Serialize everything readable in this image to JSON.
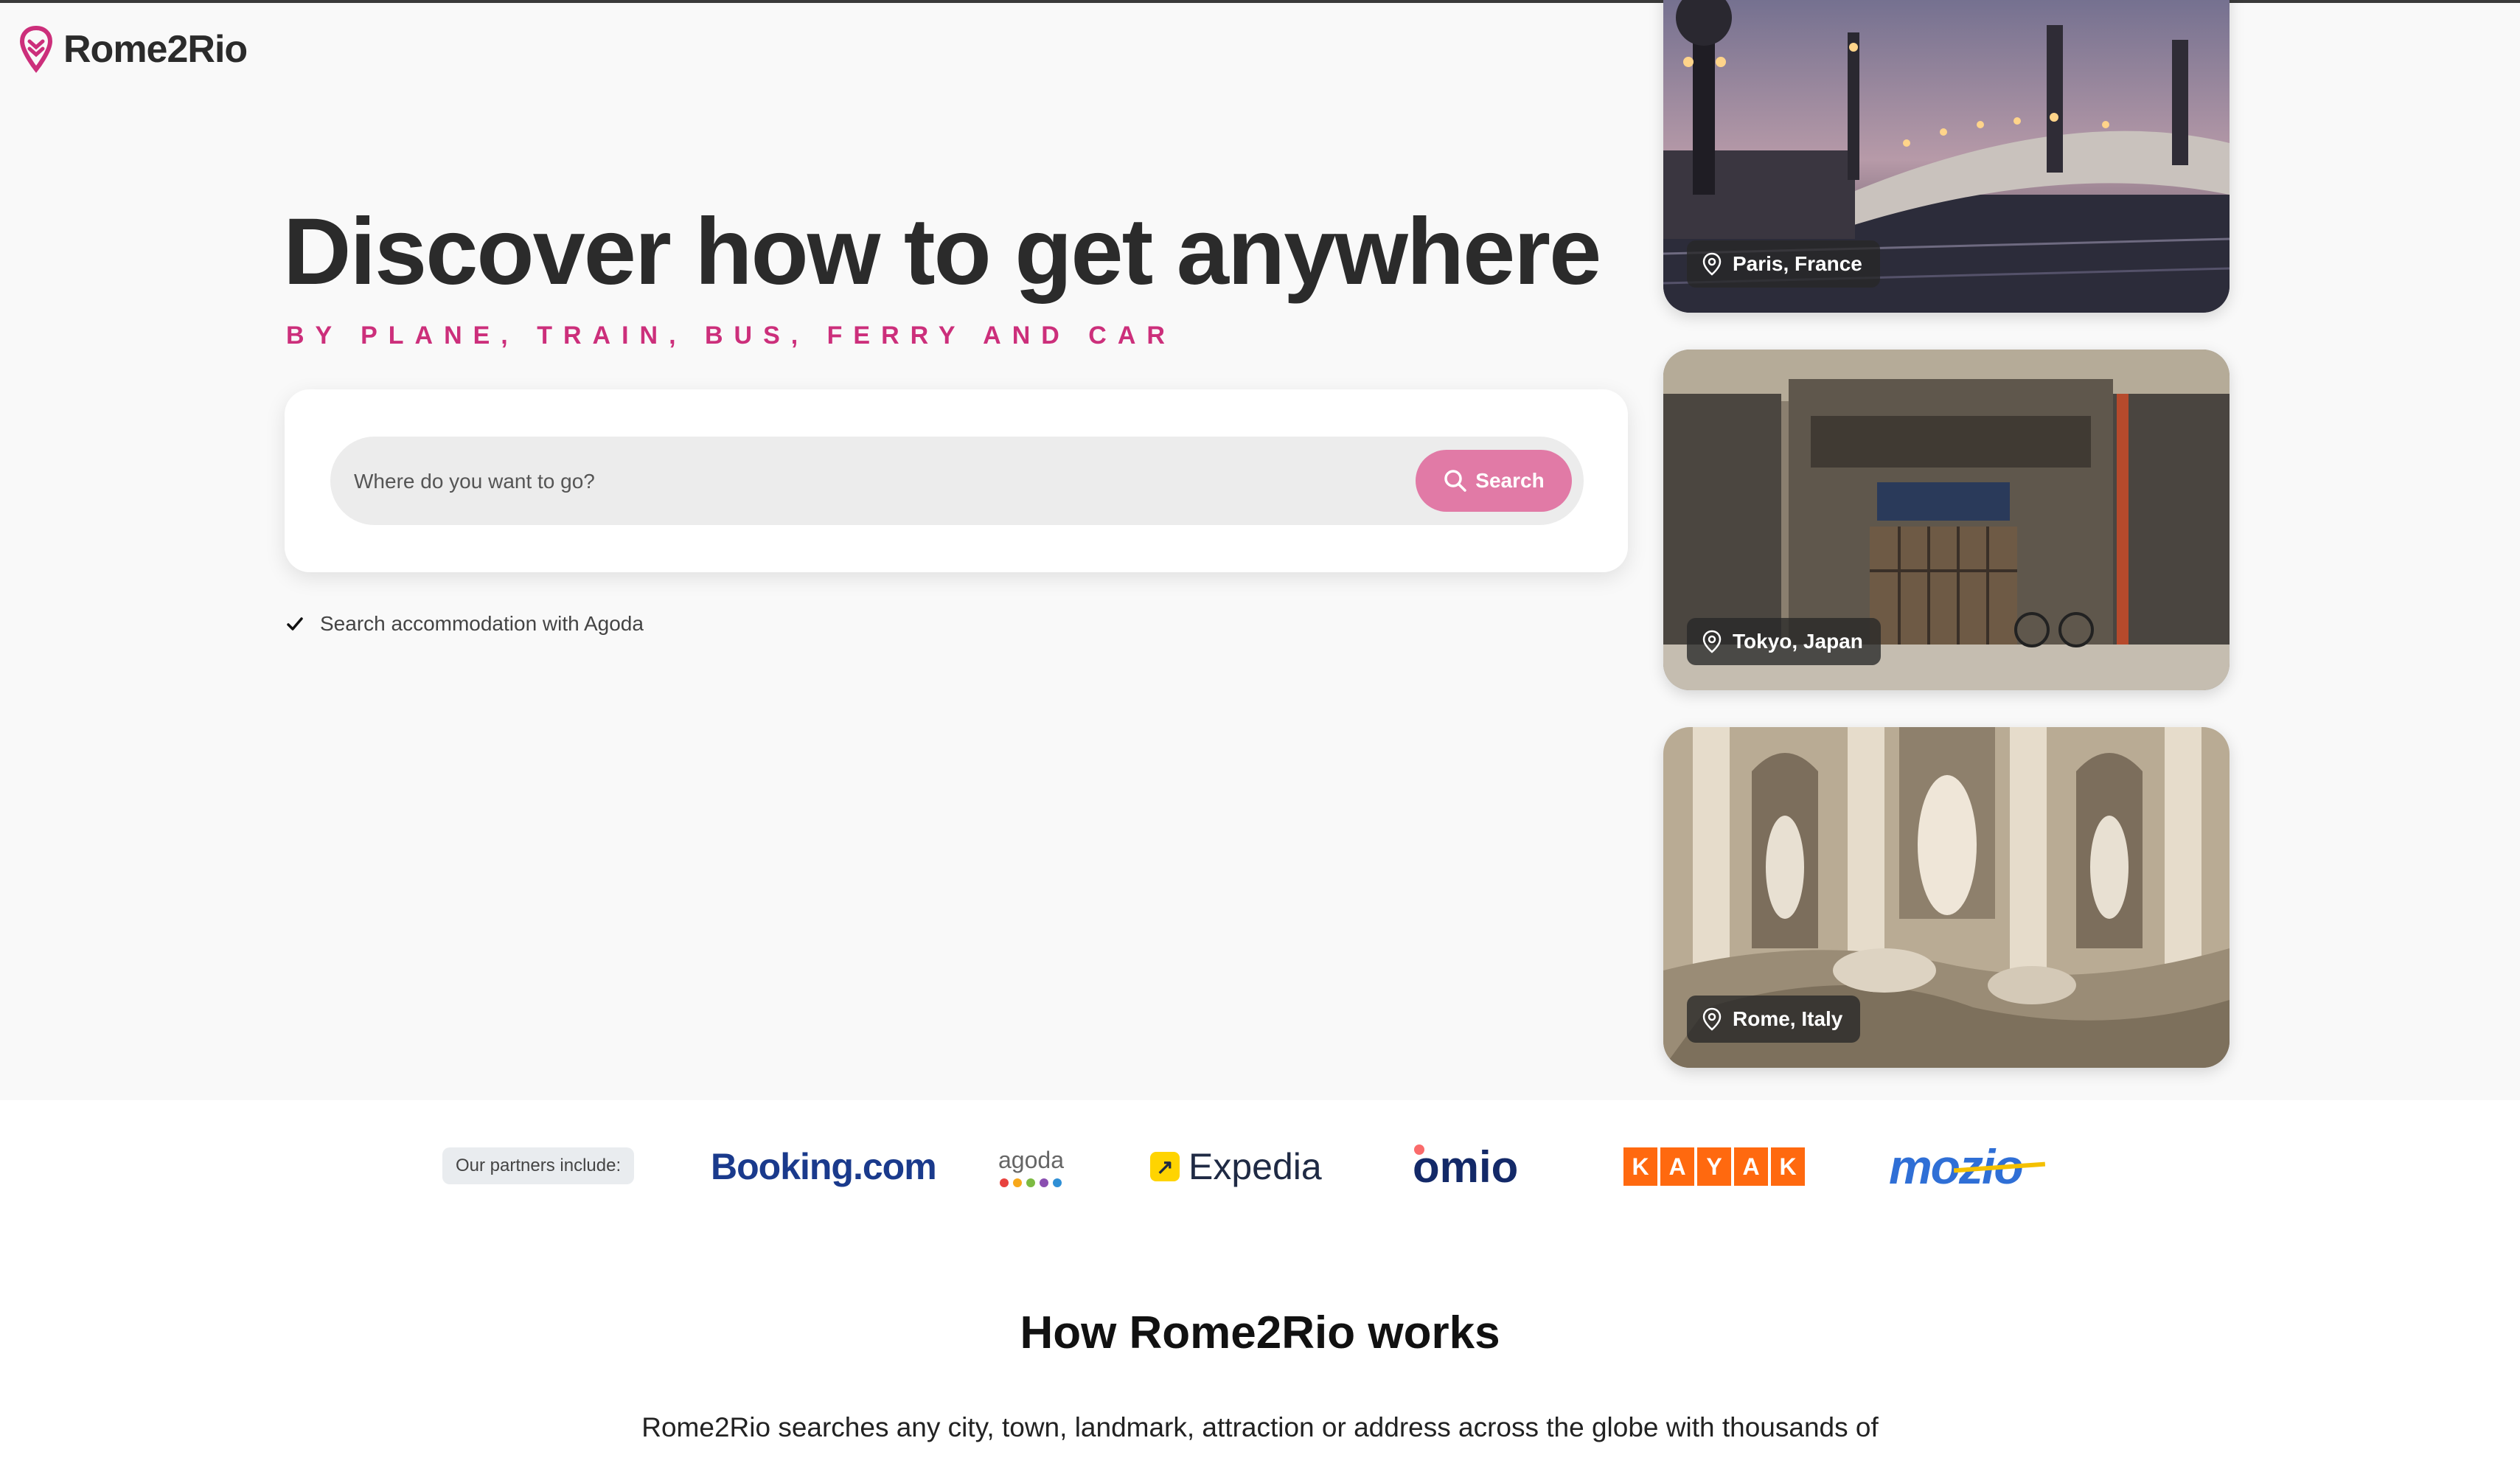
{
  "brand": {
    "name": "Rome2Rio",
    "accent_color": "#cc2f7b"
  },
  "hero": {
    "title": "Discover how to get anywhere",
    "subtitle": "BY PLANE, TRAIN, BUS, FERRY AND CAR"
  },
  "search": {
    "placeholder": "Where do you want to go?",
    "button_label": "Search",
    "button_color": "#e17aa6",
    "button_icon": "search-icon"
  },
  "accommodation_option": {
    "label": "Search accommodation with Agoda",
    "checked": true
  },
  "destinations": [
    {
      "label": "Paris, France",
      "icon": "map-pin-icon"
    },
    {
      "label": "Tokyo, Japan",
      "icon": "map-pin-icon"
    },
    {
      "label": "Rome, Italy",
      "icon": "map-pin-icon"
    }
  ],
  "partners": {
    "label": "Our partners include:",
    "booking": "Booking.com",
    "agoda": "agoda",
    "expedia": "Expedia",
    "omio": "omio",
    "kayak": [
      "K",
      "A",
      "Y",
      "A",
      "K"
    ],
    "mozio": "mozio"
  },
  "how_it_works": {
    "title": "How Rome2Rio works",
    "body": "Rome2Rio searches any city, town, landmark, attraction or address across the globe with thousands of"
  }
}
